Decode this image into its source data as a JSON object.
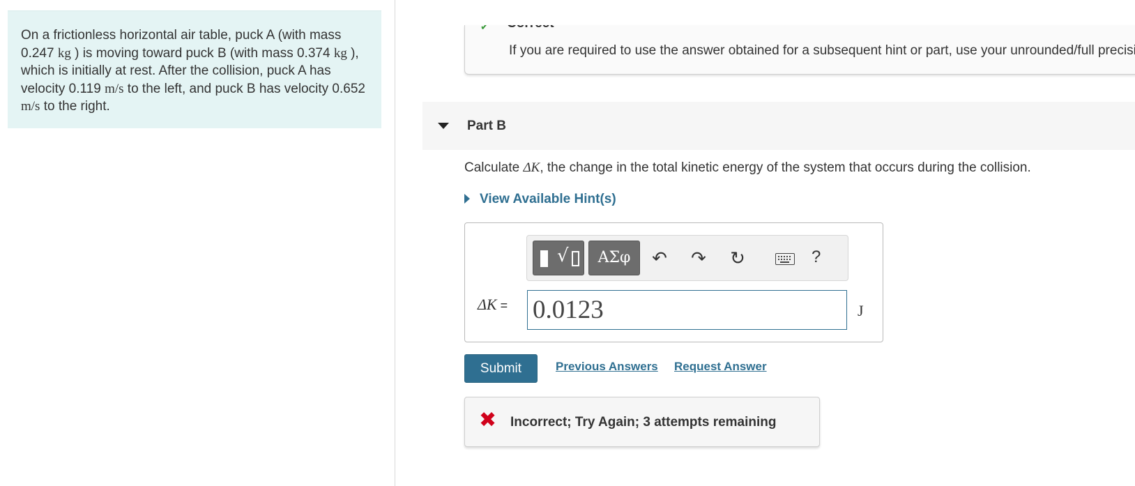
{
  "problem": {
    "text_html": "On a frictionless horizontal air table, puck A (with mass 0.247 <span class=\"math\">kg</span> ) is moving toward puck B (with mass 0.374 <span class=\"math\">kg</span> ), which is initially at rest. After the collision, puck A has velocity 0.119 <span class=\"math\">m/s</span> to the left, and puck B has velocity 0.652 <span class=\"math\">m/s</span> to the right."
  },
  "previous_part": {
    "status": "Correct",
    "note": "If you are required to use the answer obtained for a subsequent hint or part, use your unrounded/full precision answer."
  },
  "part_b": {
    "title": "Part B",
    "question_prefix": "Calculate ",
    "question_symbol": "ΔK",
    "question_suffix": ", the change in the total kinetic energy of the system that occurs during the collision.",
    "hints_label": "View Available Hint(s)"
  },
  "toolbar": {
    "greek_label": "ΑΣφ",
    "help_label": "?"
  },
  "answer": {
    "label_symbol": "ΔK",
    "label_eq": " =",
    "value": "0.0123",
    "unit": "J"
  },
  "actions": {
    "submit_label": "Submit",
    "previous_answers_label": "Previous Answers",
    "request_answer_label": "Request Answer"
  },
  "feedback": {
    "text": "Incorrect; Try Again; 3 attempts remaining"
  },
  "colors": {
    "accent": "#2f6f91",
    "problem_bg": "#e4f4f4",
    "error": "#d0021b"
  }
}
